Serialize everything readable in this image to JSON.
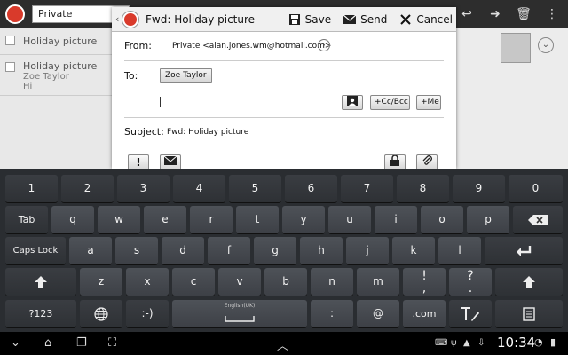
{
  "background": {
    "account": "Private",
    "list": [
      {
        "title": "Holiday picture",
        "sender": "",
        "preview": ""
      },
      {
        "title": "Holiday picture",
        "sender": "Zoe Taylor",
        "preview": "Hi"
      }
    ]
  },
  "dialog": {
    "title": "Fwd: Holiday picture",
    "save_label": "Save",
    "send_label": "Send",
    "cancel_label": "Cancel",
    "from_label": "From:",
    "from_value": "Private <alan.jones.wm@hotmail.com>",
    "to_label": "To:",
    "to_chip": "Zoe Taylor",
    "cc_bcc_label": "+Cc/Bcc",
    "me_label": "+Me",
    "subject_label": "Subject:",
    "subject_value": "Fwd: Holiday picture",
    "priority_label": "!"
  },
  "keyboard": {
    "row1": [
      "1",
      "2",
      "3",
      "4",
      "5",
      "6",
      "7",
      "8",
      "9",
      "0"
    ],
    "row2_tab": "Tab",
    "row2": [
      "q",
      "w",
      "e",
      "r",
      "t",
      "y",
      "u",
      "i",
      "o",
      "p"
    ],
    "row3_caps": "Caps Lock",
    "row3": [
      "a",
      "s",
      "d",
      "f",
      "g",
      "h",
      "j",
      "k",
      "l"
    ],
    "row4": [
      "z",
      "x",
      "c",
      "v",
      "b",
      "n",
      "m"
    ],
    "row4_excl": "!",
    "row4_comma": ",",
    "row4_q": "?",
    "row4_dot": ".",
    "row5_sym": "?123",
    "row5_smiley": ":-)",
    "row5_space": "English(UK)",
    "row5_colon": ":",
    "row5_at": "@",
    "row5_com": ".com"
  },
  "statusbar": {
    "time": "10:34"
  }
}
